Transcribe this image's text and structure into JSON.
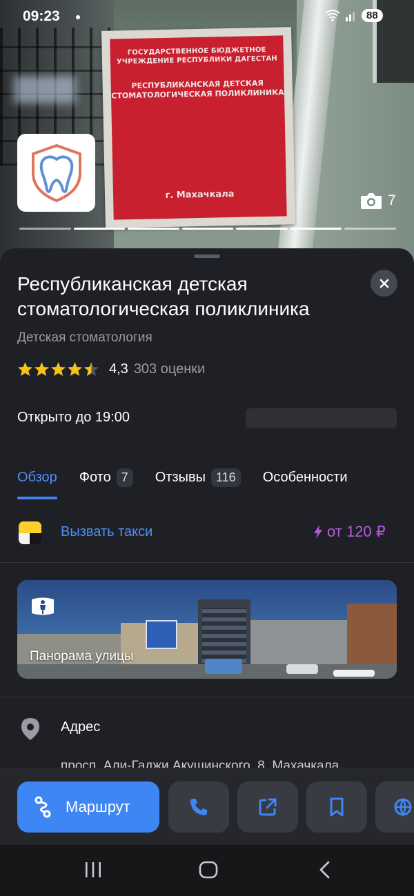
{
  "status_bar": {
    "time": "09:23",
    "battery": "88"
  },
  "hero": {
    "sign_line1": "ГОСУДАРСТВЕННОЕ БЮДЖЕТНОЕ УЧРЕЖДЕНИЕ РЕСПУБЛИКИ ДАГЕСТАН",
    "sign_line2": "РЕСПУБЛИКАНСКАЯ ДЕТСКАЯ СТОМАТОЛОГИЧЕСКАЯ ПОЛИКЛИНИКА",
    "sign_city": "г. Махачкала",
    "photo_count": "7",
    "carousel_total": 7,
    "carousel_active": [
      1,
      2,
      3,
      4,
      5
    ]
  },
  "place": {
    "title": "Республиканская детская стоматологическая поликлиника",
    "category": "Детская стоматология",
    "rating_value": "4,3",
    "rating_stars": 4.5,
    "rating_count": "303 оценки",
    "hours": "Открыто до 19:00"
  },
  "tabs": [
    {
      "label": "Обзор",
      "badge": ""
    },
    {
      "label": "Фото",
      "badge": "7"
    },
    {
      "label": "Отзывы",
      "badge": "116"
    },
    {
      "label": "Особенности",
      "badge": ""
    }
  ],
  "taxi": {
    "label": "Вызвать такси",
    "price": "от 120 ₽"
  },
  "panorama": {
    "label": "Панорама улицы"
  },
  "address": {
    "label": "Адрес",
    "value": "просп. Али-Гаджи Акушинского, 8, Махачкала"
  },
  "actions": {
    "route_label": "Маршрут"
  },
  "colors": {
    "accent": "#3f86f5",
    "price": "#b45ad8",
    "sheet": "#1f2026",
    "star": "#f5c21b"
  }
}
